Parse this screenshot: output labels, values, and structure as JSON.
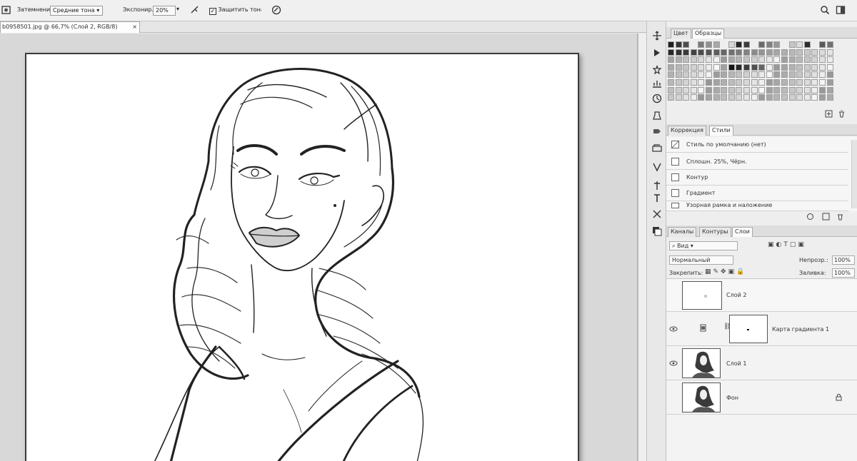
{
  "options_bar": {
    "mode_label": "Затемнение:",
    "mode_value": "Средние тона",
    "exposure_label": "Экспонир.:",
    "exposure_value": "20%",
    "protect_tones_label": "Защитить тона",
    "icons": [
      "tool-preset-icon",
      "airbrush-icon",
      "pressure-icon",
      "search-icon",
      "workspace-icon"
    ]
  },
  "document": {
    "tab_title": "b0958501.jpg @ 66,7% (Слой 2, RGB/8)",
    "close_glyph": "×"
  },
  "tools": [
    "move-icon",
    "marquee-icon",
    "lasso-icon",
    "brush-icon",
    "clone-icon",
    "history-icon",
    "eraser-icon",
    "gradient-icon",
    "dodge-icon",
    "pen-icon",
    "type-icon",
    "hand-icon",
    "zoom-icon",
    "color-icon"
  ],
  "swatches_panel": {
    "tabs": [
      "Цвет",
      "Образцы"
    ],
    "active_tab": "Образцы"
  },
  "adjustments_panel": {
    "tabs": [
      "Коррекция",
      "Стили"
    ],
    "active_tab": "Стили",
    "items": [
      "Стиль по умолчанию (нет)",
      "Сплошн. 25%, Чёрн.",
      "Контур",
      "Градиент",
      "Узорная рамка и наложение"
    ]
  },
  "layers_panel": {
    "tabs": [
      "Каналы",
      "Контуры",
      "Слои"
    ],
    "active_tab": "Слои",
    "filter_label": "Вид",
    "blend_mode": "Нормальный",
    "opacity_label": "Непрозр.:",
    "opacity_value": "100%",
    "lock_label": "Закрепить:",
    "fill_label": "Заливка:",
    "fill_value": "100%",
    "layers": [
      {
        "name": "Слой 2",
        "visible": false,
        "kind": "blank"
      },
      {
        "name": "Карта градиента 1",
        "visible": true,
        "kind": "adjustment"
      },
      {
        "name": "Слой 1",
        "visible": true,
        "kind": "portrait"
      },
      {
        "name": "Фон",
        "visible": false,
        "kind": "portrait",
        "locked": true
      }
    ]
  }
}
